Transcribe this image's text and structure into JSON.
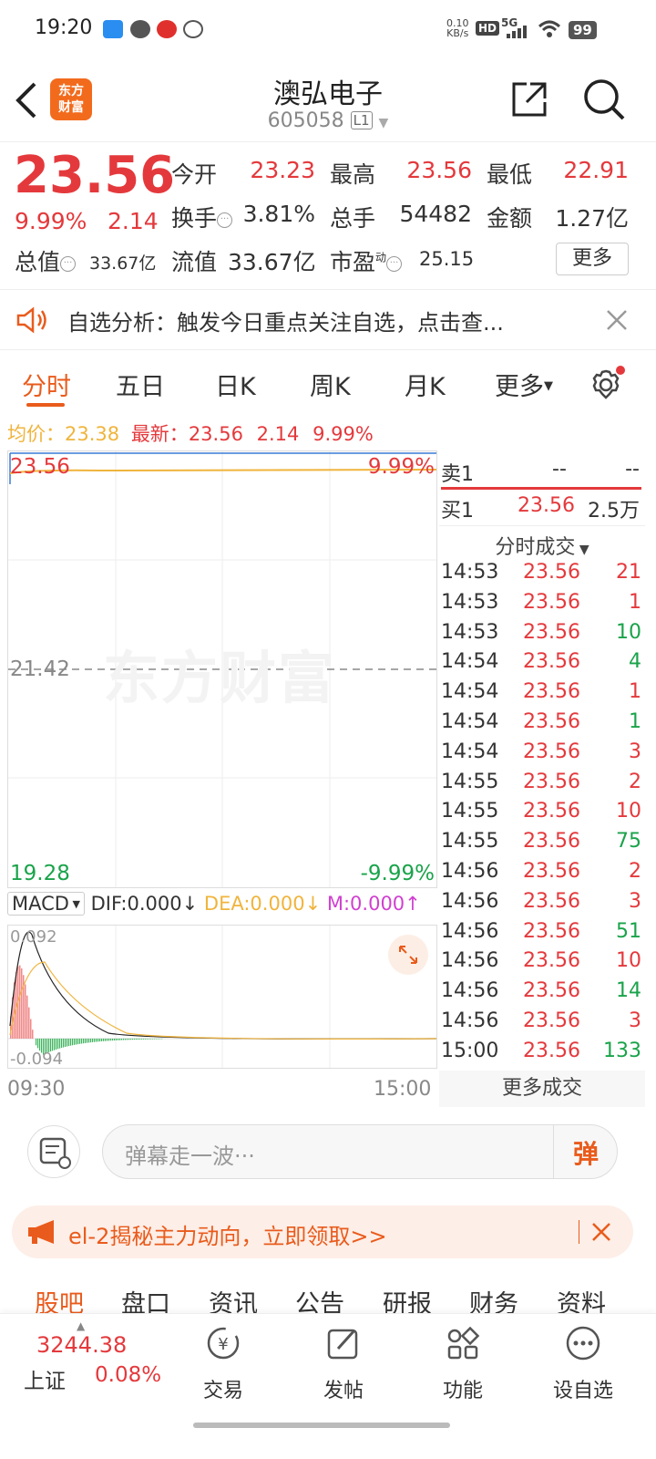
{
  "status_bar": {
    "time": "19:20",
    "net_speed_value": "0.10",
    "net_speed_unit": "KB/s",
    "hd": "HD",
    "signal": "5G",
    "battery": "99"
  },
  "header": {
    "logo_text_1": "东方",
    "logo_text_2": "财富",
    "stock_name": "澳弘电子",
    "stock_code": "605058",
    "level_badge": "L1"
  },
  "quote": {
    "price": "23.56",
    "change_pct": "9.99%",
    "change": "2.14",
    "open_label": "今开",
    "open": "23.23",
    "high_label": "最高",
    "high": "23.56",
    "low_label": "最低",
    "low": "22.91",
    "turnover_label": "换手",
    "turnover": "3.81%",
    "volume_label": "总手",
    "volume": "54482",
    "amount_label": "金额",
    "amount": "1.27亿",
    "total_value_label": "总值",
    "total_value": "33.67亿",
    "float_value_label": "流值",
    "float_value": "33.67亿",
    "pe_label": "市盈",
    "pe_sup": "动",
    "pe": "25.15",
    "more": "更多"
  },
  "analysis": {
    "text": "自选分析：触发今日重点关注自选，点击查..."
  },
  "tabs": [
    "分时",
    "五日",
    "日K",
    "周K",
    "月K",
    "更多"
  ],
  "chart_header": {
    "avg_label": "均价：",
    "avg": "23.38",
    "latest_label": "最新：",
    "latest": "23.56",
    "change": "2.14",
    "pct": "9.99%"
  },
  "chart_labels": {
    "top_price": "23.56",
    "top_pct": "9.99%",
    "mid_price": "21.42",
    "bottom_price": "19.28",
    "bottom_pct": "-9.99%",
    "watermark": "东方财富",
    "time_start": "09:30",
    "time_end": "15:00"
  },
  "macd": {
    "name": "MACD",
    "dif": "DIF:0.000",
    "dea": "DEA:0.000",
    "m": "M:0.000",
    "top": "0.092",
    "bottom": "-0.094"
  },
  "order_book": {
    "sell1_label": "卖1",
    "sell1_price": "--",
    "sell1_vol": "--",
    "buy1_label": "买1",
    "buy1_price": "23.56",
    "buy1_vol": "2.5万",
    "trades_title": "分时成交"
  },
  "trades": [
    {
      "time": "14:53",
      "price": "23.56",
      "vol": "21",
      "dir": "buy"
    },
    {
      "time": "14:53",
      "price": "23.56",
      "vol": "1",
      "dir": "buy"
    },
    {
      "time": "14:53",
      "price": "23.56",
      "vol": "10",
      "dir": "sell"
    },
    {
      "time": "14:54",
      "price": "23.56",
      "vol": "4",
      "dir": "sell"
    },
    {
      "time": "14:54",
      "price": "23.56",
      "vol": "1",
      "dir": "buy"
    },
    {
      "time": "14:54",
      "price": "23.56",
      "vol": "1",
      "dir": "sell"
    },
    {
      "time": "14:54",
      "price": "23.56",
      "vol": "3",
      "dir": "buy"
    },
    {
      "time": "14:55",
      "price": "23.56",
      "vol": "2",
      "dir": "buy"
    },
    {
      "time": "14:55",
      "price": "23.56",
      "vol": "10",
      "dir": "buy"
    },
    {
      "time": "14:55",
      "price": "23.56",
      "vol": "75",
      "dir": "sell"
    },
    {
      "time": "14:56",
      "price": "23.56",
      "vol": "2",
      "dir": "buy"
    },
    {
      "time": "14:56",
      "price": "23.56",
      "vol": "3",
      "dir": "buy"
    },
    {
      "time": "14:56",
      "price": "23.56",
      "vol": "51",
      "dir": "sell"
    },
    {
      "time": "14:56",
      "price": "23.56",
      "vol": "10",
      "dir": "buy"
    },
    {
      "time": "14:56",
      "price": "23.56",
      "vol": "14",
      "dir": "sell"
    },
    {
      "time": "14:56",
      "price": "23.56",
      "vol": "3",
      "dir": "buy"
    },
    {
      "time": "15:00",
      "price": "23.56",
      "vol": "133",
      "dir": "sell"
    }
  ],
  "more_trades": "更多成交",
  "danmu": {
    "placeholder": "弹幕走一波···",
    "button": "弹"
  },
  "promo": {
    "text": "el-2揭秘主力动向，立即领取>>"
  },
  "bottom_tabs": [
    "股吧",
    "盘口",
    "资讯",
    "公告",
    "研报",
    "财务",
    "资料"
  ],
  "footer": {
    "index_value": "3244.38",
    "index_name": "上证",
    "index_pct": "0.08%",
    "trade": "交易",
    "post": "发帖",
    "features": "功能",
    "watchlist": "设自选"
  },
  "colors": {
    "up": "#e4393c",
    "down": "#1aa34a",
    "accent": "#e95b1c",
    "avg_line": "#f0b43c"
  }
}
